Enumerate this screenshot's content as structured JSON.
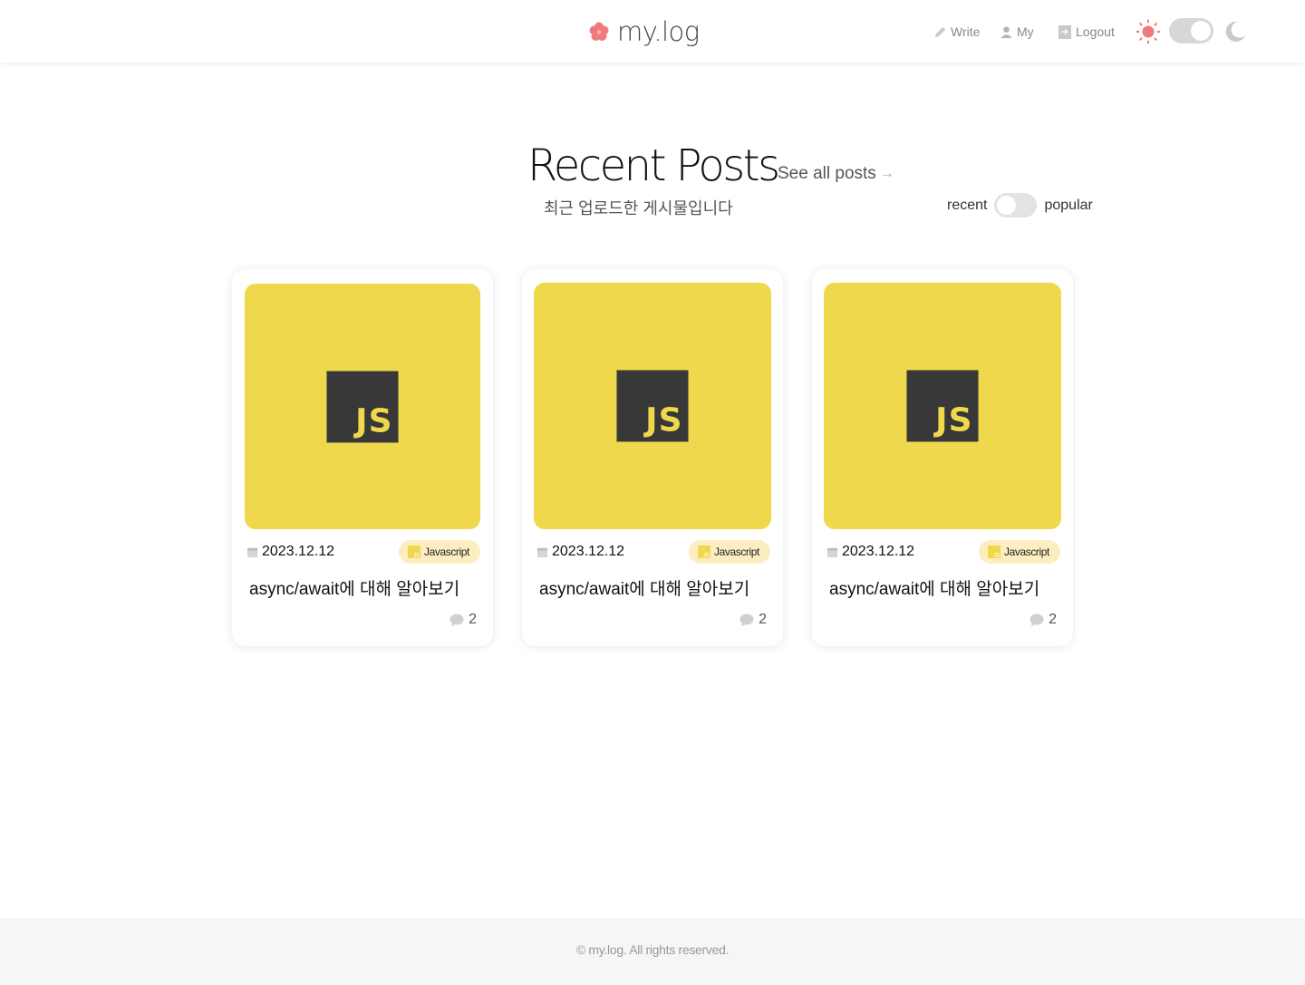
{
  "header": {
    "logo_text": "my.log",
    "nav": {
      "write": "Write",
      "my": "My",
      "logout": "Logout"
    },
    "theme": "light"
  },
  "section": {
    "title": "Recent Posts",
    "see_all": "See all posts",
    "subtitle": "최근 업로드한 게시물입니다",
    "sort_left": "recent",
    "sort_right": "popular",
    "sort_selected": "recent"
  },
  "posts": [
    {
      "date": "2023.12.12",
      "tag": "Javascript",
      "title": "async/await에 대해 알아보기",
      "comments": "2",
      "thumb_text": "JS"
    },
    {
      "date": "2023.12.12",
      "tag": "Javascript",
      "title": "async/await에 대해 알아보기",
      "comments": "2",
      "thumb_text": "JS"
    },
    {
      "date": "2023.12.12",
      "tag": "Javascript",
      "title": "async/await에 대해 알아보기",
      "comments": "2",
      "thumb_text": "JS"
    }
  ],
  "footer": {
    "text": "© my.log. All rights reserved."
  },
  "colors": {
    "accent": "#f07a7a",
    "js_yellow": "#efd84c",
    "js_dark": "#383838",
    "tag_bg": "#fdeec1"
  }
}
